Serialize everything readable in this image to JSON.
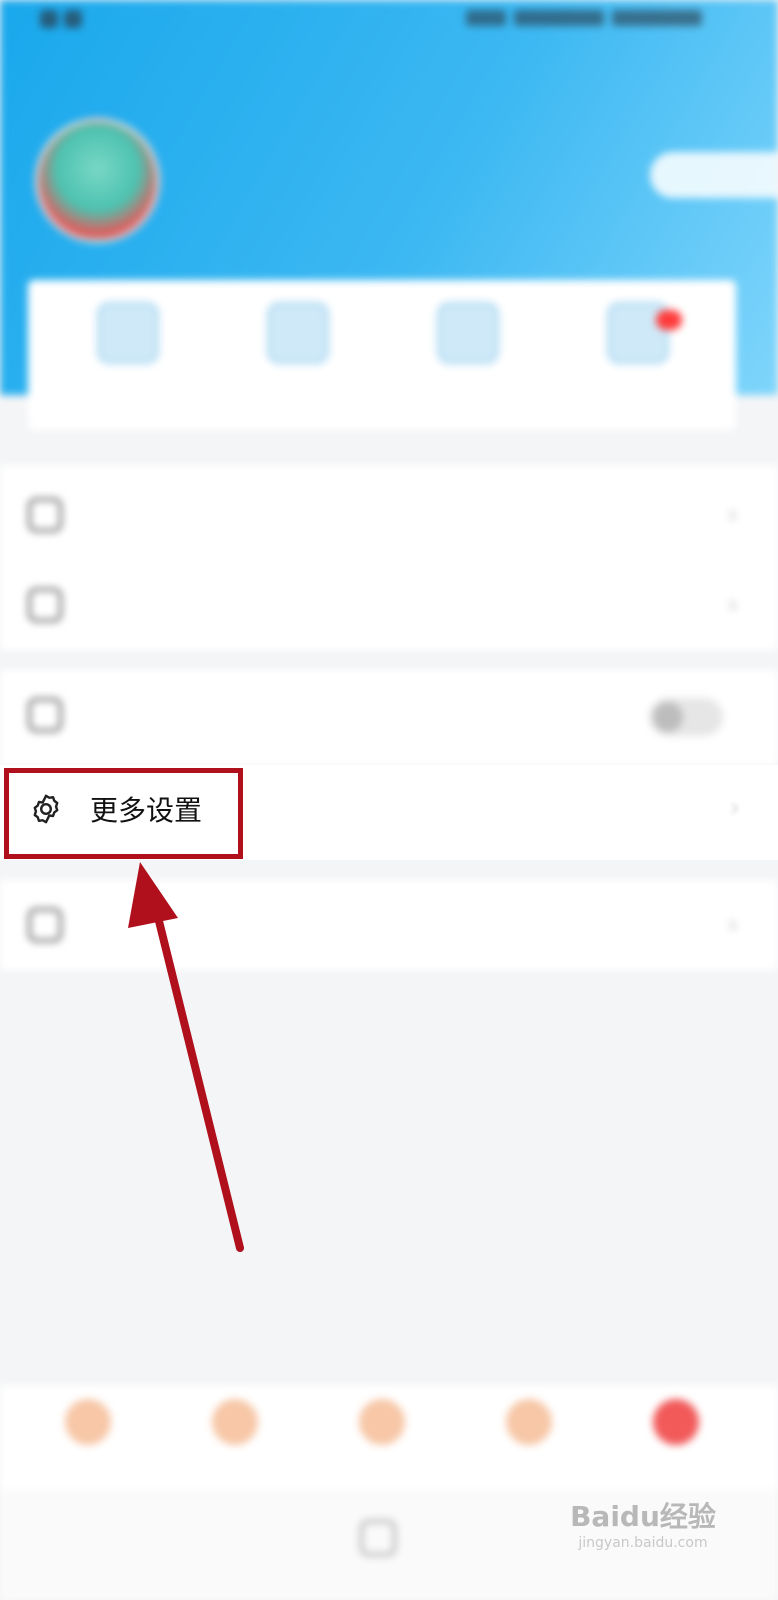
{
  "status_bar": {
    "left": "",
    "right": ""
  },
  "profile": {
    "username": "",
    "meta": "",
    "button_label": ""
  },
  "quick_actions": [
    {
      "label": ""
    },
    {
      "label": ""
    },
    {
      "label": ""
    },
    {
      "label": ""
    }
  ],
  "menu_group_1": [
    {
      "label": "",
      "value": ""
    },
    {
      "label": ""
    }
  ],
  "menu_group_2": [
    {
      "label": ""
    },
    {
      "label": "更多设置"
    }
  ],
  "menu_group_3": [
    {
      "label": ""
    }
  ],
  "bottom_nav": [
    {
      "label": ""
    },
    {
      "label": ""
    },
    {
      "label": ""
    },
    {
      "label": ""
    },
    {
      "label": ""
    }
  ],
  "watermark": {
    "brand": "Baidu经验",
    "site": "jingyan.baidu.com"
  },
  "colors": {
    "header_gradient_start": "#19a8ec",
    "header_gradient_end": "#7fd5fb",
    "highlight": "#b00f1c"
  }
}
